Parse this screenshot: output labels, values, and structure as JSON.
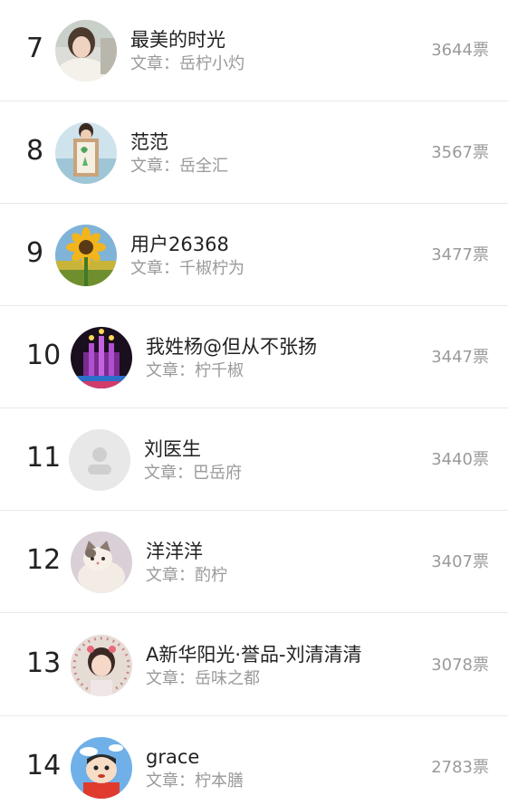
{
  "ranking": {
    "items": [
      {
        "rank": "7",
        "name": "最美的时光",
        "article": "文章：岳柠小灼",
        "votes": "3644票",
        "avatar": "woman-photo-avatar"
      },
      {
        "rank": "8",
        "name": "范范",
        "article": "文章：岳全汇",
        "votes": "3567票",
        "avatar": "child-with-drawing-avatar"
      },
      {
        "rank": "9",
        "name": "用户26368",
        "article": "文章：千椒柠为",
        "votes": "3477票",
        "avatar": "sunflower-avatar"
      },
      {
        "rank": "10",
        "name": "我姓杨@但从不张扬",
        "article": "文章：柠千椒",
        "votes": "3447票",
        "avatar": "night-castle-avatar"
      },
      {
        "rank": "11",
        "name": "刘医生",
        "article": "文章：巴岳府",
        "votes": "3440票",
        "avatar": "default-user-avatar"
      },
      {
        "rank": "12",
        "name": "洋洋洋",
        "article": "文章：酌柠",
        "votes": "3407票",
        "avatar": "cat-avatar"
      },
      {
        "rank": "13",
        "name": "A新华阳光·誉品-刘清清清",
        "article": "文章：岳味之都",
        "votes": "3078票",
        "avatar": "girl-photo-avatar"
      },
      {
        "rank": "14",
        "name": "grace",
        "article": "文章：柠本膳",
        "votes": "2783票",
        "avatar": "cartoon-boy-avatar"
      }
    ]
  }
}
